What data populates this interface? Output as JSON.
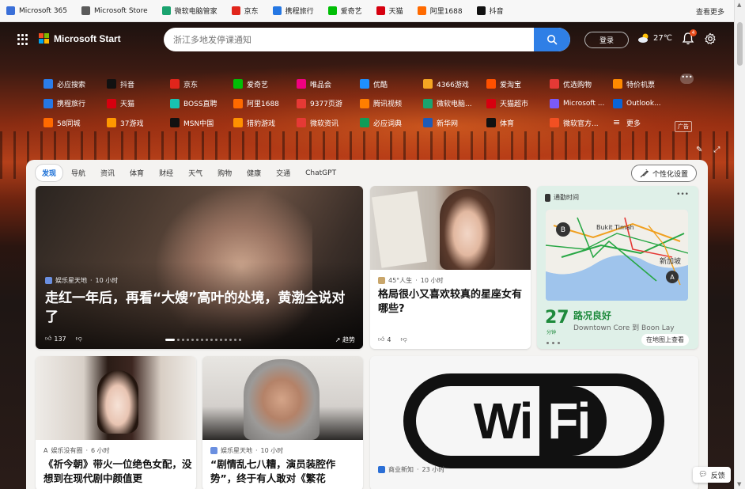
{
  "favorites": {
    "items": [
      {
        "label": "Microsoft 365",
        "color": "#3a6fd8"
      },
      {
        "label": "Microsoft Store",
        "color": "#5a5a5a"
      },
      {
        "label": "微软电脑管家",
        "color": "#1aa36f"
      },
      {
        "label": "京东",
        "color": "#e1251b"
      },
      {
        "label": "携程旅行",
        "color": "#2577e3"
      },
      {
        "label": "爱奇艺",
        "color": "#00be06"
      },
      {
        "label": "天猫",
        "color": "#d6000f"
      },
      {
        "label": "阿里1688",
        "color": "#ff6a00"
      },
      {
        "label": "抖音",
        "color": "#111111"
      }
    ],
    "more_label": "查看更多"
  },
  "header": {
    "brand": "Microsoft Start",
    "search_placeholder": "浙江多地发停课通知",
    "login_label": "登录",
    "temperature": "27℃",
    "notification_count": "4"
  },
  "quick_links": {
    "rows": [
      [
        {
          "label": "必应搜索",
          "color": "#2b7de9"
        },
        {
          "label": "抖音",
          "color": "#111111"
        },
        {
          "label": "京东",
          "color": "#e1251b"
        },
        {
          "label": "爱奇艺",
          "color": "#00be06"
        },
        {
          "label": "唯品会",
          "color": "#f10180"
        },
        {
          "label": "优酷",
          "color": "#1e90ff"
        },
        {
          "label": "4366游戏",
          "color": "#f5a623"
        },
        {
          "label": "爱淘宝",
          "color": "#ff5000"
        },
        {
          "label": "优选购物",
          "color": "#e53935"
        },
        {
          "label": "特价机票",
          "color": "#ff8a00"
        }
      ],
      [
        {
          "label": "携程旅行",
          "color": "#2577e3"
        },
        {
          "label": "天猫",
          "color": "#d6000f"
        },
        {
          "label": "BOSS直聘",
          "color": "#18c3b1"
        },
        {
          "label": "阿里1688",
          "color": "#ff6a00"
        },
        {
          "label": "9377页游",
          "color": "#e53935"
        },
        {
          "label": "腾讯视频",
          "color": "#ff7e00"
        },
        {
          "label": "微软电脑...",
          "color": "#1aa36f"
        },
        {
          "label": "天猫超市",
          "color": "#d6000f"
        },
        {
          "label": "Microsoft ...",
          "color": "#7a5af8"
        },
        {
          "label": "Outlook...",
          "color": "#0a64d6"
        }
      ],
      [
        {
          "label": "58同城",
          "color": "#ff6a00"
        },
        {
          "label": "37游戏",
          "color": "#ff9800"
        },
        {
          "label": "MSN中国",
          "color": "#111111"
        },
        {
          "label": "猎豹游戏",
          "color": "#ff9100"
        },
        {
          "label": "微软资讯",
          "color": "#e53935"
        },
        {
          "label": "必应词典",
          "color": "#0f9d58"
        },
        {
          "label": "新华网",
          "color": "#1e5bb8"
        },
        {
          "label": "体育",
          "color": "#111111"
        },
        {
          "label": "微软官方...",
          "color": "#f25022"
        },
        {
          "label": "更多",
          "color": "transparent"
        }
      ]
    ],
    "ad_label": "广告"
  },
  "feed": {
    "tabs": [
      "发现",
      "导航",
      "资讯",
      "体育",
      "财经",
      "天气",
      "购物",
      "健康",
      "交通",
      "ChatGPT"
    ],
    "active_tab": "发现",
    "personalize_label": "个性化设置"
  },
  "cards": {
    "main": {
      "source": "娱乐星天地",
      "time": "10 小时",
      "title": "走红一年后，再看“大嫂”高叶的处境，黄渤全说对了",
      "likes": "137",
      "trend_label": "趋势"
    },
    "girl": {
      "source": "45°人生",
      "time": "10 小时",
      "title": "格局很小又喜欢较真的星座女有哪些?",
      "likes": "4"
    },
    "traffic": {
      "header": "通勤时间",
      "map_labels": [
        "Bukit Timah",
        "新加坡"
      ],
      "minutes": "27",
      "unit": "分钟",
      "status": "路况良好",
      "route": "Downtown Core 到 Boon Lay",
      "map_button": "在地图上查看"
    },
    "bottom": [
      {
        "source": "娱乐没有圈",
        "time": "6 小时",
        "title": "《祈今朝》带火一位绝色女配，没想到在现代剧中颜值更"
      },
      {
        "source": "娱乐星天地",
        "time": "10 小时",
        "title": "“剧情乱七八糟，演员装腔作势”，终于有人敢对《繁花"
      },
      {
        "source": "商业新知",
        "time": "23 小时",
        "title": "…WiFi…………………………"
      }
    ]
  },
  "feedback_label": "反馈"
}
